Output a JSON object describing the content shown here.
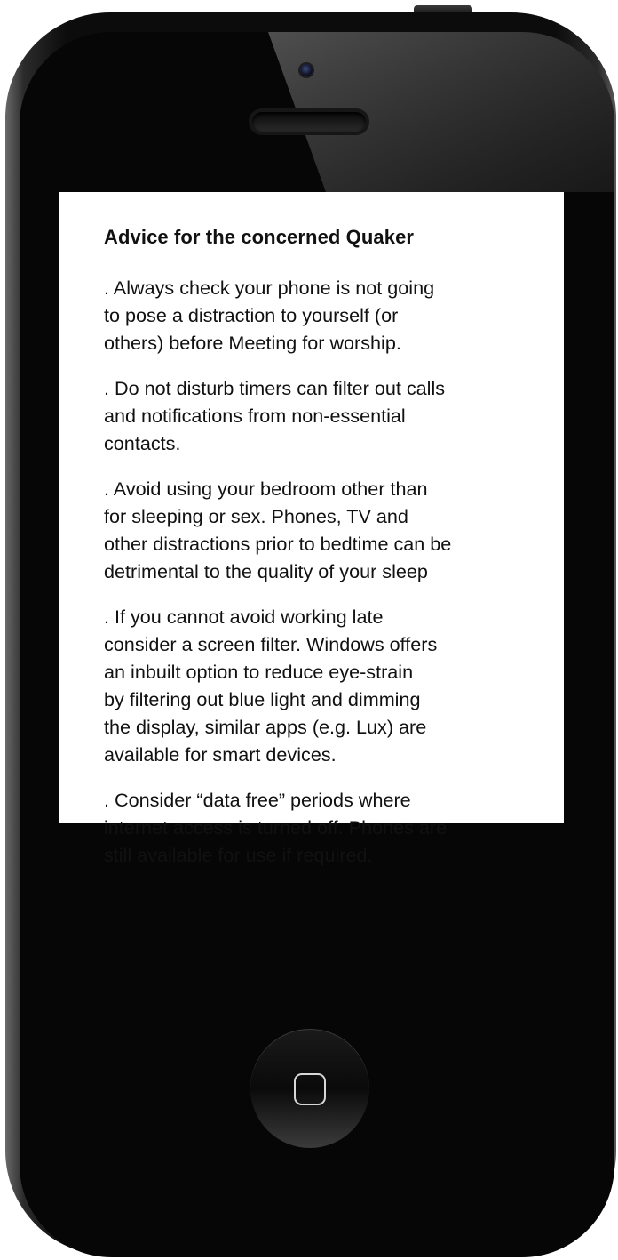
{
  "screen": {
    "title": "Advice for the concerned Quaker",
    "tips": [
      [
        ". Always check your phone is not going",
        "to pose a distraction to yourself (or",
        "others) before Meeting for worship."
      ],
      [
        ". Do not disturb timers can filter out calls",
        "and notifications from non-essential",
        "contacts."
      ],
      [
        ". Avoid using your bedroom other than",
        "for sleeping or sex. Phones, TV and",
        "other distractions prior to bedtime can be",
        "detrimental to the quality of your sleep"
      ],
      [
        ". If you cannot avoid working late",
        "consider a screen filter. Windows offers",
        "an inbuilt option to reduce eye-strain",
        "by filtering out blue light and dimming",
        "the display, similar apps (e.g. Lux) are",
        "available for smart devices."
      ],
      [
        ". Consider “data free” periods where",
        "internet access is turned off. Phones are",
        "still available for use if required."
      ]
    ]
  },
  "device": {
    "frame_color": "#0c0c0c",
    "screen_color": "#ffffff",
    "home_button_icon": "rounded-square-icon",
    "camera_icon": "front-camera-icon",
    "speaker_icon": "earpiece-speaker-icon"
  }
}
